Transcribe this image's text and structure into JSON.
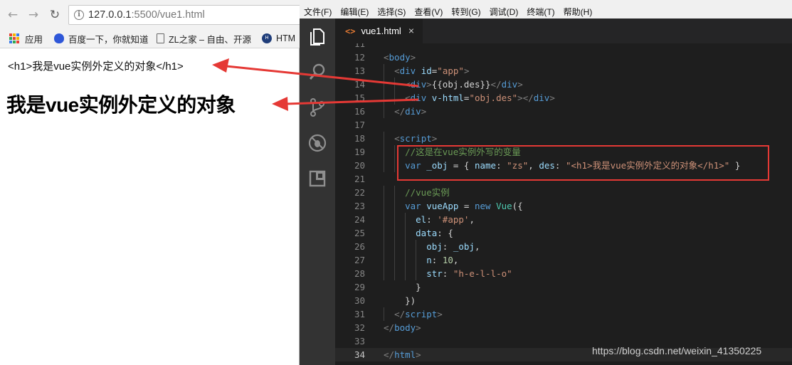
{
  "browser": {
    "url_host": "127.0.0.1",
    "url_rest": ":5500/vue1.html",
    "bookmarks": [
      "应用",
      "百度一下，你就知道",
      "ZL之家 – 自由、开源",
      "HTM"
    ],
    "raw_line": "<h1>我是vue实例外定义的对象</h1>",
    "rendered_heading": "我是vue实例外定义的对象"
  },
  "editor": {
    "menu": [
      "文件(F)",
      "编辑(E)",
      "选择(S)",
      "查看(V)",
      "转到(G)",
      "调试(D)",
      "终端(T)",
      "帮助(H)"
    ],
    "tab_label": "vue1.html",
    "tab_icon": "<>",
    "tab_close": "×",
    "lines": [
      {
        "n": "11",
        "tokens": []
      },
      {
        "n": "12",
        "tokens": [
          [
            "punc",
            "<"
          ],
          [
            "tag",
            "body"
          ],
          [
            "punc",
            ">"
          ]
        ]
      },
      {
        "n": "13",
        "tokens": [
          [
            "txt",
            "  "
          ],
          [
            "punc",
            "<"
          ],
          [
            "tag",
            "div"
          ],
          [
            "txt",
            " "
          ],
          [
            "attr",
            "id"
          ],
          [
            "txt",
            "="
          ],
          [
            "str",
            "\"app\""
          ],
          [
            "punc",
            ">"
          ]
        ]
      },
      {
        "n": "14",
        "tokens": [
          [
            "txt",
            "    "
          ],
          [
            "punc",
            "<"
          ],
          [
            "tag",
            "div"
          ],
          [
            "punc",
            ">"
          ],
          [
            "txt",
            "{{obj.des}}"
          ],
          [
            "punc",
            "</"
          ],
          [
            "tag",
            "div"
          ],
          [
            "punc",
            ">"
          ]
        ]
      },
      {
        "n": "15",
        "tokens": [
          [
            "txt",
            "    "
          ],
          [
            "punc",
            "<"
          ],
          [
            "tag",
            "div"
          ],
          [
            "txt",
            " "
          ],
          [
            "attr",
            "v-html"
          ],
          [
            "txt",
            "="
          ],
          [
            "str",
            "\"obj.des\""
          ],
          [
            "punc",
            "></"
          ],
          [
            "tag",
            "div"
          ],
          [
            "punc",
            ">"
          ]
        ]
      },
      {
        "n": "16",
        "tokens": [
          [
            "txt",
            "  "
          ],
          [
            "punc",
            "</"
          ],
          [
            "tag",
            "div"
          ],
          [
            "punc",
            ">"
          ]
        ]
      },
      {
        "n": "17",
        "tokens": []
      },
      {
        "n": "18",
        "tokens": [
          [
            "txt",
            "  "
          ],
          [
            "punc",
            "<"
          ],
          [
            "tag",
            "script"
          ],
          [
            "punc",
            ">"
          ]
        ]
      },
      {
        "n": "19",
        "tokens": [
          [
            "txt",
            "    "
          ],
          [
            "cmt",
            "//这是在vue实例外写的变量"
          ]
        ]
      },
      {
        "n": "20",
        "tokens": [
          [
            "txt",
            "    "
          ],
          [
            "kw",
            "var"
          ],
          [
            "txt",
            " "
          ],
          [
            "var",
            "_obj"
          ],
          [
            "txt",
            " = { "
          ],
          [
            "var",
            "name"
          ],
          [
            "txt",
            ": "
          ],
          [
            "str",
            "\"zs\""
          ],
          [
            "txt",
            ", "
          ],
          [
            "var",
            "des"
          ],
          [
            "txt",
            ": "
          ],
          [
            "str",
            "\"<h1>我是vue实例外定义的对象</h1>\""
          ],
          [
            "txt",
            " }"
          ]
        ]
      },
      {
        "n": "21",
        "tokens": []
      },
      {
        "n": "22",
        "tokens": [
          [
            "txt",
            "    "
          ],
          [
            "cmt",
            "//vue实例"
          ]
        ]
      },
      {
        "n": "23",
        "tokens": [
          [
            "txt",
            "    "
          ],
          [
            "kw",
            "var"
          ],
          [
            "txt",
            " "
          ],
          [
            "var",
            "vueApp"
          ],
          [
            "txt",
            " = "
          ],
          [
            "kw",
            "new"
          ],
          [
            "txt",
            " "
          ],
          [
            "cls",
            "Vue"
          ],
          [
            "txt",
            "({"
          ]
        ]
      },
      {
        "n": "24",
        "tokens": [
          [
            "txt",
            "      "
          ],
          [
            "var",
            "el"
          ],
          [
            "txt",
            ": "
          ],
          [
            "str",
            "'#app'"
          ],
          [
            "txt",
            ","
          ]
        ]
      },
      {
        "n": "25",
        "tokens": [
          [
            "txt",
            "      "
          ],
          [
            "var",
            "data"
          ],
          [
            "txt",
            ": {"
          ]
        ]
      },
      {
        "n": "26",
        "tokens": [
          [
            "txt",
            "        "
          ],
          [
            "var",
            "obj"
          ],
          [
            "txt",
            ": "
          ],
          [
            "var",
            "_obj"
          ],
          [
            "txt",
            ","
          ]
        ]
      },
      {
        "n": "27",
        "tokens": [
          [
            "txt",
            "        "
          ],
          [
            "var",
            "n"
          ],
          [
            "txt",
            ": "
          ],
          [
            "num",
            "10"
          ],
          [
            "txt",
            ","
          ]
        ]
      },
      {
        "n": "28",
        "tokens": [
          [
            "txt",
            "        "
          ],
          [
            "var",
            "str"
          ],
          [
            "txt",
            ": "
          ],
          [
            "str",
            "\"h-e-l-l-o\""
          ]
        ]
      },
      {
        "n": "29",
        "tokens": [
          [
            "txt",
            "      }"
          ]
        ]
      },
      {
        "n": "30",
        "tokens": [
          [
            "txt",
            "    })"
          ]
        ]
      },
      {
        "n": "31",
        "tokens": [
          [
            "txt",
            "  "
          ],
          [
            "punc",
            "</"
          ],
          [
            "tag",
            "script"
          ],
          [
            "punc",
            ">"
          ]
        ]
      },
      {
        "n": "32",
        "tokens": [
          [
            "punc",
            "</"
          ],
          [
            "tag",
            "body"
          ],
          [
            "punc",
            ">"
          ]
        ]
      },
      {
        "n": "33",
        "tokens": []
      },
      {
        "n": "34",
        "tokens": [
          [
            "punc",
            "</"
          ],
          [
            "tag",
            "html"
          ],
          [
            "punc",
            ">"
          ]
        ]
      }
    ],
    "active_line": "34"
  },
  "watermark": "https://blog.csdn.net/weixin_41350225",
  "colors": {
    "annotation_red": "#e53935",
    "editor_bg": "#1e1e1e",
    "activity_bar": "#333333"
  },
  "icons": [
    "back-arrow-icon",
    "forward-arrow-icon",
    "reload-icon",
    "info-icon",
    "apps-grid-icon",
    "baidu-paw-icon",
    "document-icon",
    "html-globe-icon",
    "explorer-files-icon",
    "search-icon",
    "source-control-icon",
    "debug-icon",
    "extensions-icon",
    "html-file-icon",
    "close-icon"
  ]
}
